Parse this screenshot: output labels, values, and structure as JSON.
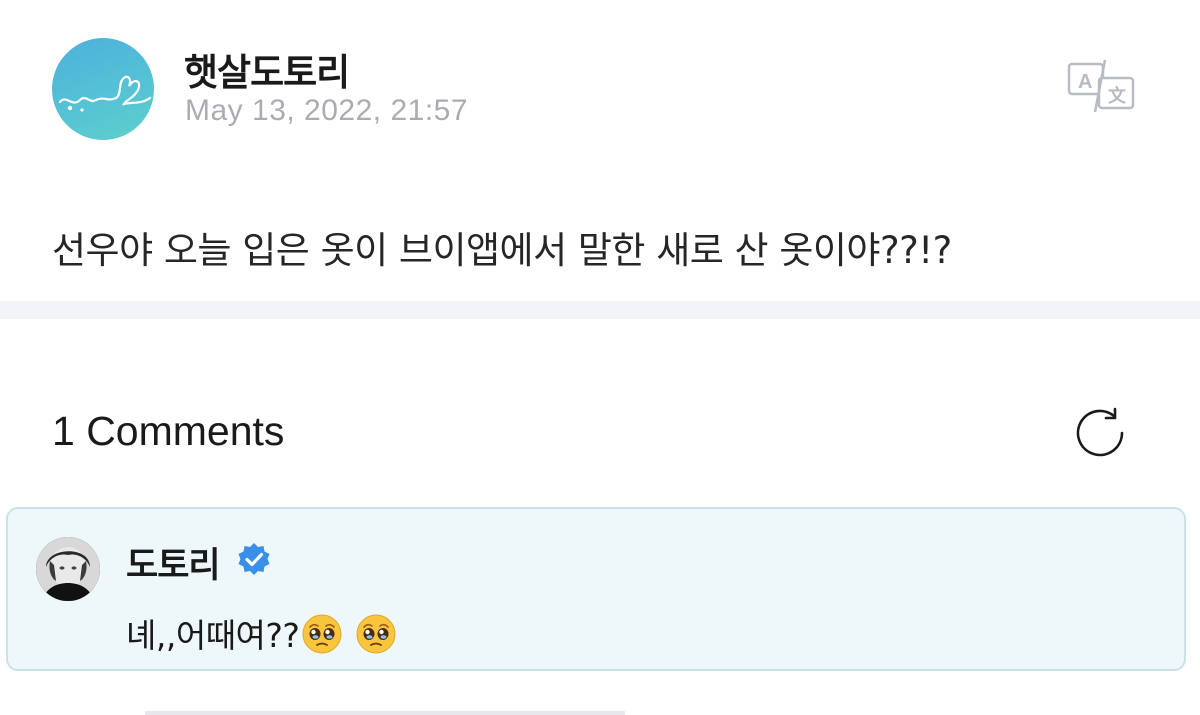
{
  "post": {
    "author": "햇살도토리",
    "date": "May 13, 2022, 21:57",
    "body": "선우야 오늘 입은 옷이 브이앱에서 말한 새로 산 옷이야??!?",
    "translate_icon": "translate-icon"
  },
  "comments": {
    "header": "1 Comments",
    "refresh_icon": "refresh-icon",
    "items": [
      {
        "author": "도토리",
        "verified": true,
        "text": "녜,,어때여??",
        "emojis": [
          "pleading-face-emoji",
          "pleading-face-emoji"
        ]
      }
    ]
  },
  "colors": {
    "comment_bg": "#eef8fb",
    "comment_border": "#c9e2ea",
    "verified_blue": "#3a8fe8",
    "date_gray": "#a9adb3",
    "divider": "#f2f4f7"
  }
}
